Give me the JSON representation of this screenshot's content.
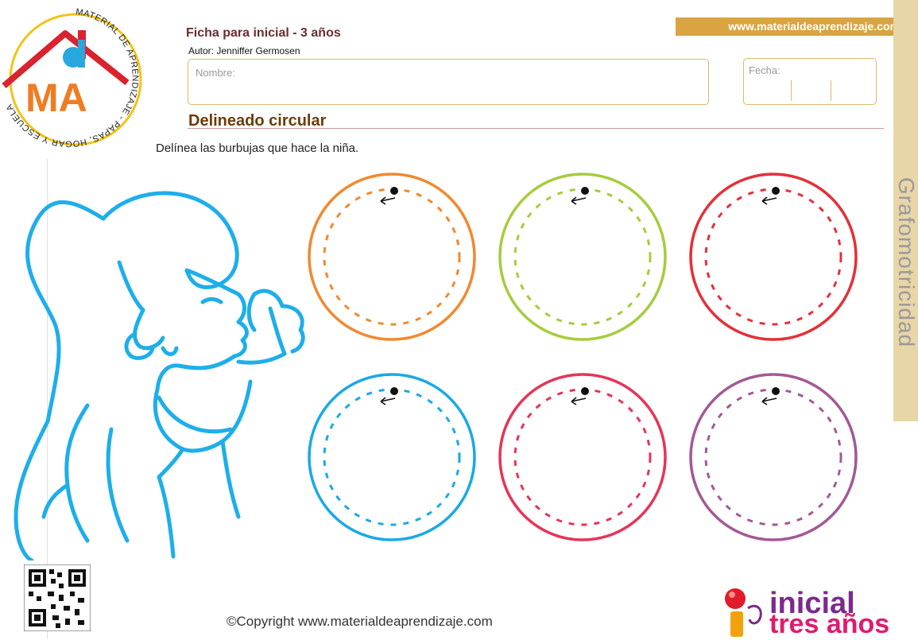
{
  "header": {
    "logo": {
      "arc_text": "MATERIAL DE APRENDIZAJE - PAPAS, HOGAR Y ESCUELA",
      "monogram": "MA",
      "colors": {
        "red": "#d9232e",
        "orange": "#f07c22",
        "blue": "#29a8e0",
        "yellow": "#f2c318"
      }
    },
    "title": "Ficha para inicial - 3 años",
    "author": "Autor: Jenniffer Germosen",
    "name_label": "Nombre:",
    "date_label": "Fecha:",
    "url": "www.materialdeaprendizaje.com"
  },
  "sidebar": {
    "label": "Grafomotricidad"
  },
  "section": {
    "title": "Delineado circular",
    "instruction": "Delínea las burbujas que hace la niña."
  },
  "illustration": {
    "name": "girl-blowing-bubbles",
    "stroke_color": "#1eaeea"
  },
  "bubbles": [
    {
      "color": "#f08a30",
      "direction_arrow": "counter-clockwise"
    },
    {
      "color": "#a6cc3e",
      "direction_arrow": "counter-clockwise"
    },
    {
      "color": "#e3313a",
      "direction_arrow": "counter-clockwise"
    },
    {
      "color": "#1aa9e6",
      "direction_arrow": "counter-clockwise"
    },
    {
      "color": "#e53558",
      "direction_arrow": "counter-clockwise"
    },
    {
      "color": "#a25a95",
      "direction_arrow": "counter-clockwise"
    }
  ],
  "footer": {
    "qr_icon": "qr-code-icon",
    "copyright": "©Copyright www.materialdeaprendizaje.com",
    "brand_line1": "inicial",
    "brand_line2": "tres años"
  }
}
